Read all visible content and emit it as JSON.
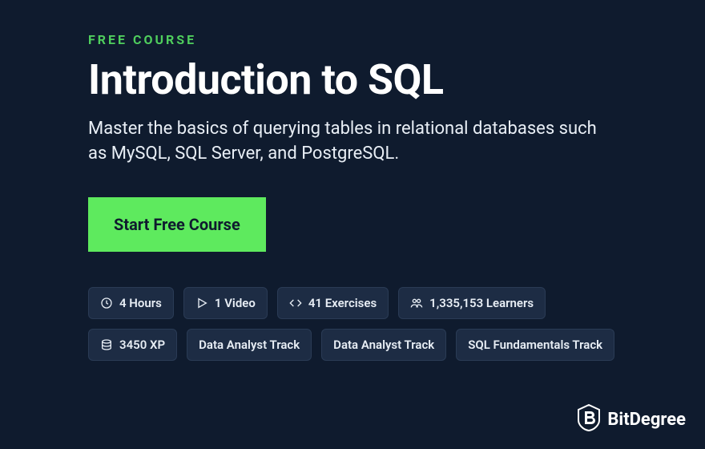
{
  "eyebrow": "FREE COURSE",
  "title": "Introduction to SQL",
  "description": "Master the basics of querying tables in relational databases such as MySQL, SQL Server, and PostgreSQL.",
  "cta": {
    "label": "Start Free Course"
  },
  "chips": [
    {
      "icon": "clock-icon",
      "label": "4 Hours"
    },
    {
      "icon": "play-icon",
      "label": "1 Video"
    },
    {
      "icon": "code-icon",
      "label": "41 Exercises"
    },
    {
      "icon": "learners-icon",
      "label": "1,335,153 Learners"
    },
    {
      "icon": "xp-icon",
      "label": "3450 XP"
    },
    {
      "icon": null,
      "label": "Data Analyst Track"
    },
    {
      "icon": null,
      "label": "Data Analyst Track"
    },
    {
      "icon": null,
      "label": "SQL Fundamentals Track"
    }
  ],
  "brand": {
    "name": "BitDegree"
  }
}
